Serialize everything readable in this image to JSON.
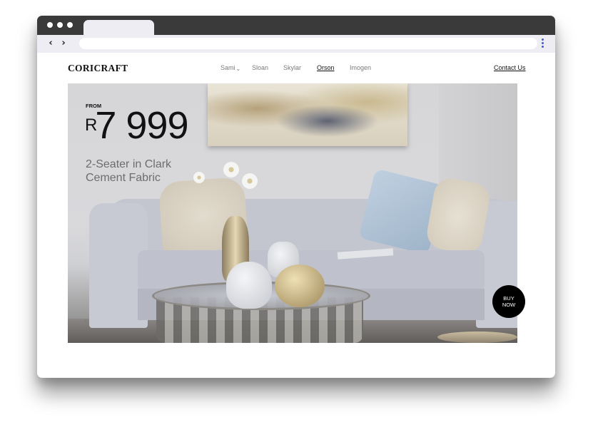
{
  "brand": {
    "logo_text": "CORICRAFT"
  },
  "nav": {
    "items": [
      {
        "label": "Sami",
        "has_dropdown": true,
        "active": false
      },
      {
        "label": "Sloan",
        "has_dropdown": false,
        "active": false
      },
      {
        "label": "Skylar",
        "has_dropdown": false,
        "active": false
      },
      {
        "label": "Orson",
        "has_dropdown": false,
        "active": true
      },
      {
        "label": "Imogen",
        "has_dropdown": false,
        "active": false
      }
    ],
    "contact_label": "Contact Us",
    "dropdown_icon": "chevron-down-icon"
  },
  "hero": {
    "from_label": "FROM",
    "currency": "R",
    "price": "7 999",
    "description_line1": "2-Seater in Clark",
    "description_line2": "Cement Fabric",
    "buy_line1": "BUY",
    "buy_line2": "NOW",
    "scroll_icon": "chevron-down-icon"
  },
  "browser": {
    "back_icon": "back-arrow-icon",
    "forward_icon": "forward-arrow-icon",
    "menu_icon": "kebab-menu-icon",
    "accent_color": "#3b5bd6"
  }
}
